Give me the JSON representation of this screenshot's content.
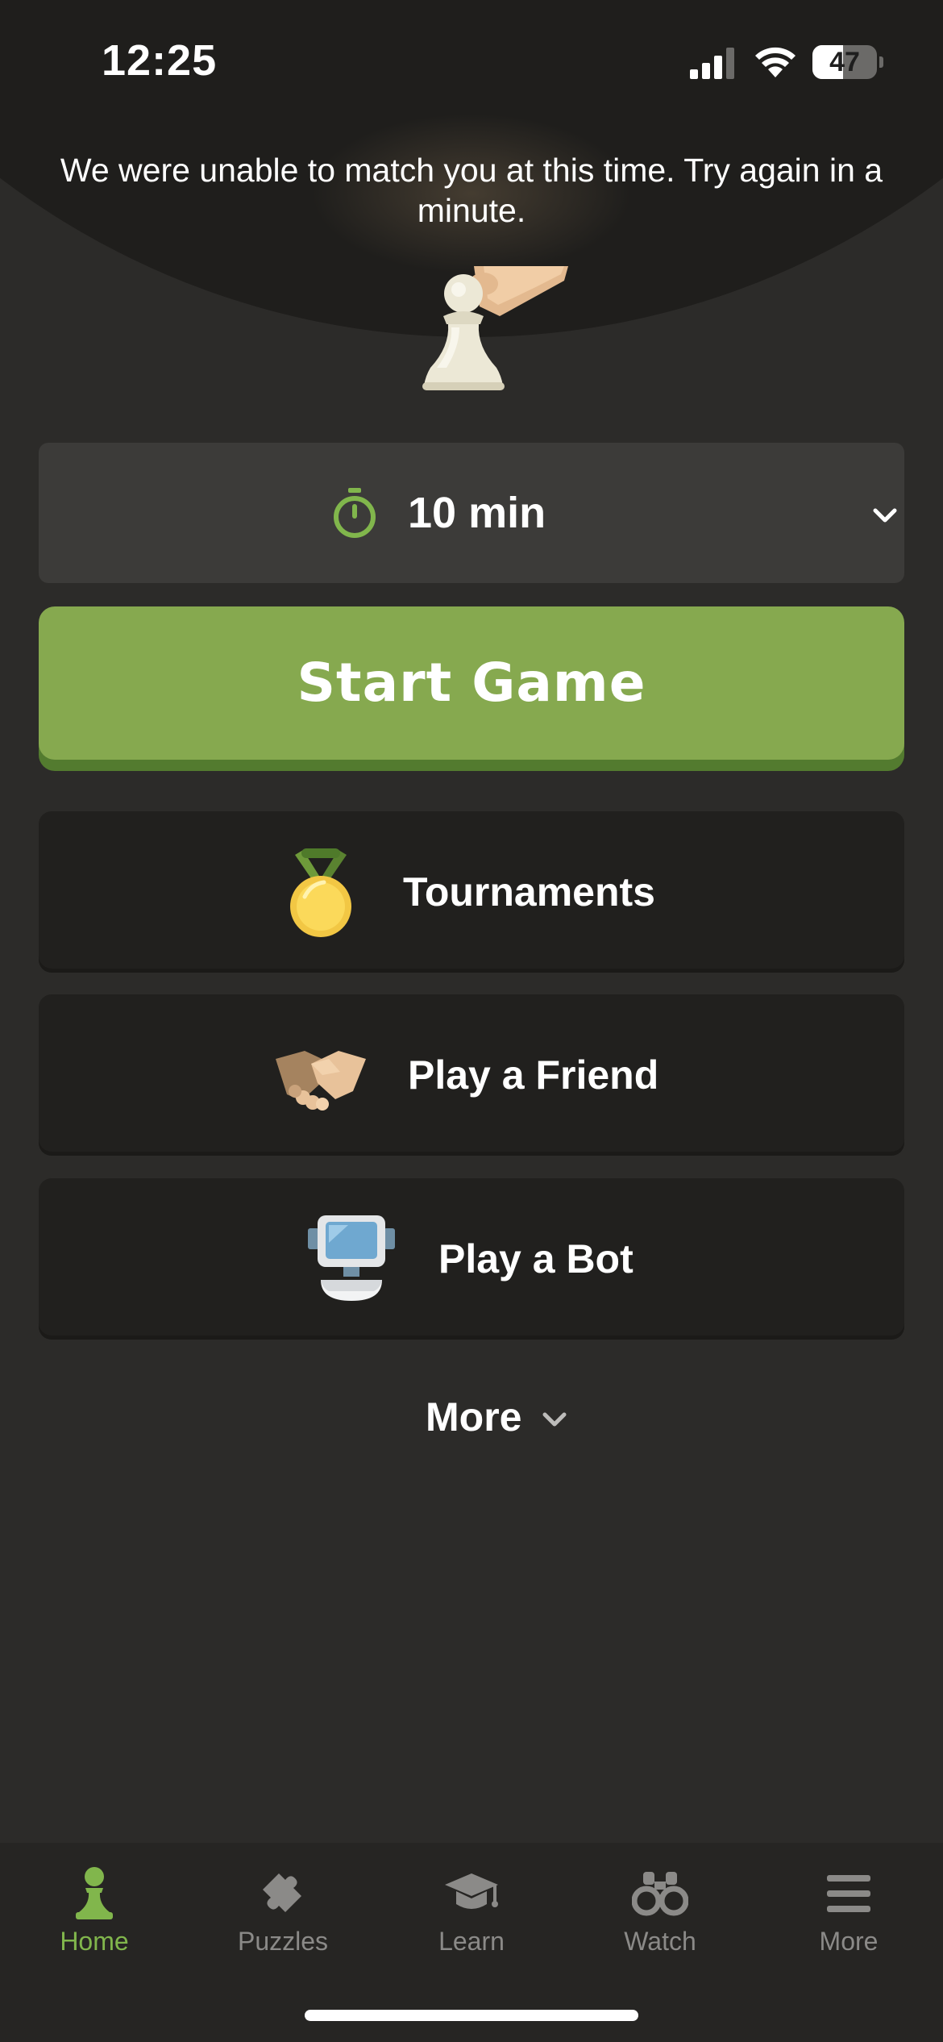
{
  "status_bar": {
    "time": "12:25",
    "battery_level": "47",
    "battery_fraction": 0.47
  },
  "notice": {
    "text": "We were unable to match you at this time. Try again in a minute."
  },
  "time_control": {
    "value": "10 min",
    "icon": "stopwatch-icon"
  },
  "start_button": {
    "label": "Start Game"
  },
  "menu": {
    "items": [
      {
        "label": "Tournaments",
        "icon": "medal-icon"
      },
      {
        "label": "Play a Friend",
        "icon": "handshake-icon"
      },
      {
        "label": "Play a Bot",
        "icon": "robot-icon"
      }
    ],
    "more_label": "More"
  },
  "bottom_nav": {
    "items": [
      {
        "label": "Home",
        "icon": "pawn-icon",
        "active": true
      },
      {
        "label": "Puzzles",
        "icon": "puzzle-icon",
        "active": false
      },
      {
        "label": "Learn",
        "icon": "graduation-cap-icon",
        "active": false
      },
      {
        "label": "Watch",
        "icon": "binoculars-icon",
        "active": false
      },
      {
        "label": "More",
        "icon": "hamburger-menu-icon",
        "active": false
      }
    ]
  },
  "colors": {
    "background": "#2c2b29",
    "header": "#1f1e1c",
    "accent_green": "#86a94f",
    "active_nav": "#81b64c",
    "card": "#21201e",
    "selector": "#3c3b39"
  }
}
